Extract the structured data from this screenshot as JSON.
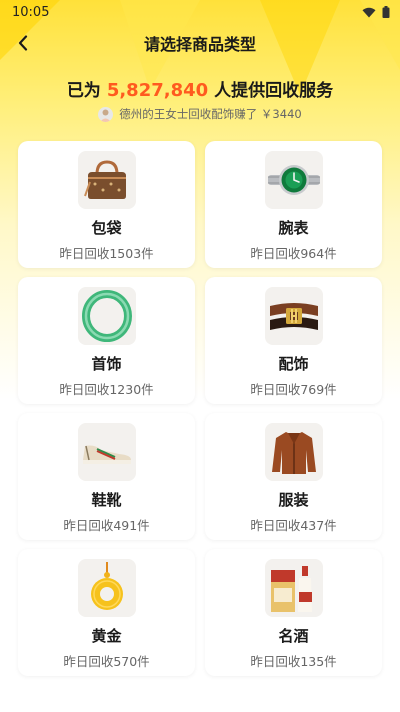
{
  "status": {
    "time": "10:05"
  },
  "nav": {
    "title": "请选择商品类型"
  },
  "headline": {
    "prefix": "已为",
    "count": "5,827,840",
    "suffix": "人提供回收服务"
  },
  "ticker": {
    "text": "德州的王女士回收配饰赚了 ￥3440"
  },
  "categories": [
    {
      "name": "包袋",
      "sub": "昨日回收1503件",
      "icon": "handbag-icon"
    },
    {
      "name": "腕表",
      "sub": "昨日回收964件",
      "icon": "watch-icon"
    },
    {
      "name": "首饰",
      "sub": "昨日回收1230件",
      "icon": "jade-bangle-icon"
    },
    {
      "name": "配饰",
      "sub": "昨日回收769件",
      "icon": "belt-icon"
    },
    {
      "name": "鞋靴",
      "sub": "昨日回收491件",
      "icon": "sneaker-icon"
    },
    {
      "name": "服装",
      "sub": "昨日回收437件",
      "icon": "leather-jacket-icon"
    },
    {
      "name": "黄金",
      "sub": "昨日回收570件",
      "icon": "gold-pendant-icon"
    },
    {
      "name": "名酒",
      "sub": "昨日回收135件",
      "icon": "liquor-bottle-icon"
    }
  ],
  "colors": {
    "accent": "#ff5a1f",
    "header_yellow": "#ffe13a"
  }
}
